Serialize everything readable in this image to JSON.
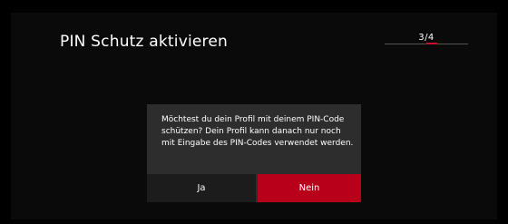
{
  "page": {
    "title": "PIN Schutz aktivieren",
    "step": "3/4",
    "step_progress": 0.75
  },
  "dialog": {
    "message": "Möchtest du dein Profil mit deinem PIN-Code schützen? Dein Profil kann danach nur noch mit Eingabe des PIN-Codes verwendet werden.",
    "yes_label": "Ja",
    "no_label": "Nein",
    "selected": "Nein"
  },
  "colors": {
    "background": "#000000",
    "dialog_background": "#2d2d2d",
    "accent": "#b8001a",
    "button_background": "#1c1c1c",
    "text": "#ffffff"
  }
}
